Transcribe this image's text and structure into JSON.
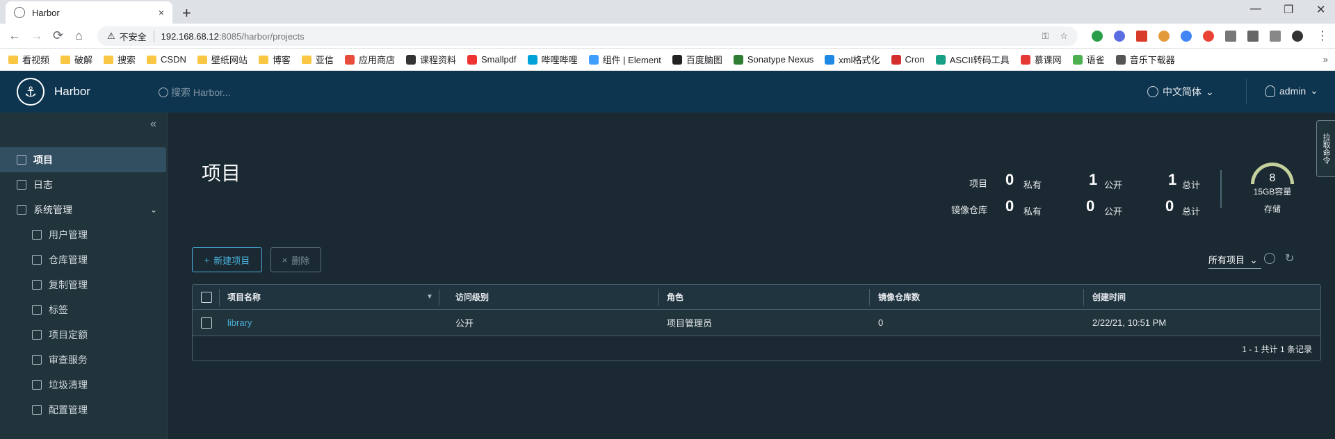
{
  "browser": {
    "tab_title": "Harbor",
    "tab_close": "×",
    "new_tab": "+",
    "nav": {
      "back": "←",
      "forward": "→",
      "reload": "⟳",
      "home": "⌂"
    },
    "security_label": "不安全",
    "url_host": "192.168.68.12",
    "url_path": ":8085/harbor/projects",
    "window": {
      "minimize": "—",
      "restore": "❐",
      "close": "✕"
    },
    "bookmarks": [
      "看视频",
      "破解",
      "搜索",
      "CSDN",
      "壁纸网站",
      "博客",
      "亚信",
      "应用商店",
      "课程资料",
      "Smallpdf",
      "哔哩哔哩",
      "组件 | Element",
      "百度脑图",
      "Sonatype Nexus",
      "xml格式化",
      "Cron",
      "ASCII转码工具",
      "慕课网",
      "语雀",
      "音乐下载器"
    ],
    "bookmarks_more": "»"
  },
  "header": {
    "brand": "Harbor",
    "search_placeholder": "搜索 Harbor...",
    "language": "中文简体",
    "user": "admin",
    "caret": "⌄"
  },
  "sidebar": {
    "collapse": "«",
    "items": [
      {
        "label": "项目"
      },
      {
        "label": "日志"
      },
      {
        "label": "系统管理"
      }
    ],
    "admin_caret": "⌄",
    "sub_items": [
      {
        "label": "用户管理"
      },
      {
        "label": "仓库管理"
      },
      {
        "label": "复制管理"
      },
      {
        "label": "标签"
      },
      {
        "label": "项目定额"
      },
      {
        "label": "审查服务"
      },
      {
        "label": "垃圾清理"
      },
      {
        "label": "配置管理"
      }
    ]
  },
  "page": {
    "title": "项目",
    "stats": {
      "projects_label": "项目",
      "repos_label": "镜像仓库",
      "projects": {
        "private": "0",
        "public": "1",
        "total": "1"
      },
      "repos": {
        "private": "0",
        "public": "0",
        "total": "0"
      },
      "private_label": "私有",
      "public_label": "公开",
      "total_label": "总计"
    },
    "storage": {
      "value": "8",
      "capacity": "15GB容量",
      "label": "存储",
      "fill_fraction": 0.05
    },
    "new_button": "新建项目",
    "new_icon": "+",
    "delete_button": "删除",
    "delete_icon": "×",
    "filter": "所有项目",
    "filter_caret": "⌄",
    "refresh_icon": "↻",
    "side_panel": "拉取命令"
  },
  "table": {
    "columns": [
      "项目名称",
      "访问级别",
      "角色",
      "镜像仓库数",
      "创建时间"
    ],
    "filter_icon": "▼",
    "rows": [
      {
        "name": "library",
        "access": "公开",
        "role": "项目管理员",
        "repos": "0",
        "created": "2/22/21, 10:51 PM"
      }
    ],
    "footer": "1 - 1 共计 1 条记录"
  },
  "colors": {
    "header_bg": "#0e3550",
    "page_bg": "#1b2a32",
    "accent": "#49aeda"
  }
}
